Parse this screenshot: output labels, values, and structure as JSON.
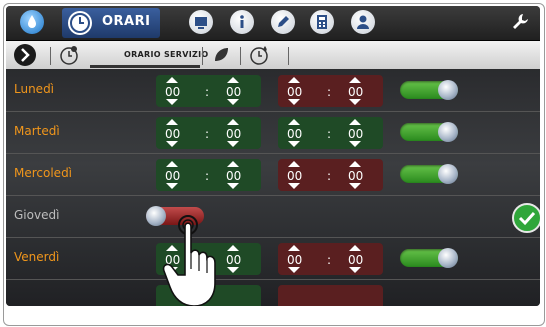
{
  "topbar": {
    "active_tab": "ORARI",
    "icons": [
      "water-drop-icon",
      "clock-icon",
      "monitor-icon",
      "info-icon",
      "pencil-icon",
      "calculator-icon",
      "user-icon",
      "wrench-icon"
    ]
  },
  "subbar": {
    "label": "ORARIO SERVIZIO",
    "icons": [
      "next-arrow-icon",
      "clock-gear-icon",
      "leaf-icon",
      "clock-drop-icon"
    ]
  },
  "schedule": {
    "rows": [
      {
        "day": "Lunedì",
        "on_h": "00",
        "on_m": "00",
        "off_h": "00",
        "off_m": "00",
        "enabled": true
      },
      {
        "day": "Martedì",
        "on_h": "00",
        "on_m": "00",
        "off_h": "00",
        "off_m": "00",
        "enabled": true
      },
      {
        "day": "Mercoledì",
        "on_h": "00",
        "on_m": "00",
        "off_h": "00",
        "off_m": "00",
        "enabled": true
      },
      {
        "day": "Giovedì",
        "enabled": false
      },
      {
        "day": "Venerdì",
        "on_h": "00",
        "on_m": "00",
        "off_h": "00",
        "off_m": "00",
        "enabled": true
      }
    ],
    "separator": ":"
  },
  "colors": {
    "accent_orange": "#f0961c",
    "on_green": "#1f4a26",
    "off_red": "#5a1f20",
    "toggle_green": "#4fae36",
    "confirm_green": "#2fa63a"
  }
}
